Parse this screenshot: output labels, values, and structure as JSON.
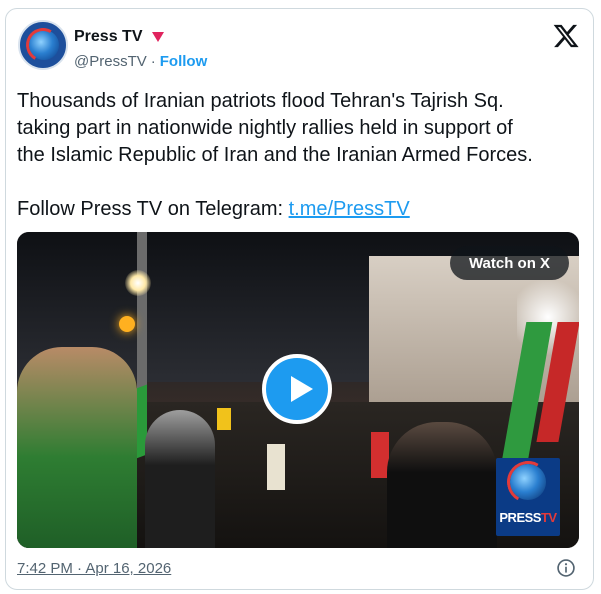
{
  "header": {
    "display_name": "Press TV",
    "handle": "@PressTV",
    "separator": "·",
    "follow_label": "Follow",
    "platform_icon": "x-logo-icon"
  },
  "tweet": {
    "line1": "Thousands of Iranian patriots flood Tehran's Tajrish Sq.",
    "line2": "taking part in nationwide nightly rallies held in support of",
    "line3": "the Islamic Republic of Iran and the Iranian Armed Forces.",
    "follow_text": "Follow Press TV on Telegram: ",
    "telegram_link": "t.me/PressTV"
  },
  "media": {
    "watch_label": "Watch on X",
    "play_icon": "play-icon",
    "logo_text_a": "PRESS",
    "logo_text_b": "TV"
  },
  "footer": {
    "timestamp": "7:42 PM · Apr 16, 2026",
    "info_icon": "info-icon"
  },
  "colors": {
    "accent": "#1d9bf0",
    "text": "#0f1419",
    "muted": "#536471",
    "border": "#cfd9de",
    "badge": "#e0245e"
  }
}
